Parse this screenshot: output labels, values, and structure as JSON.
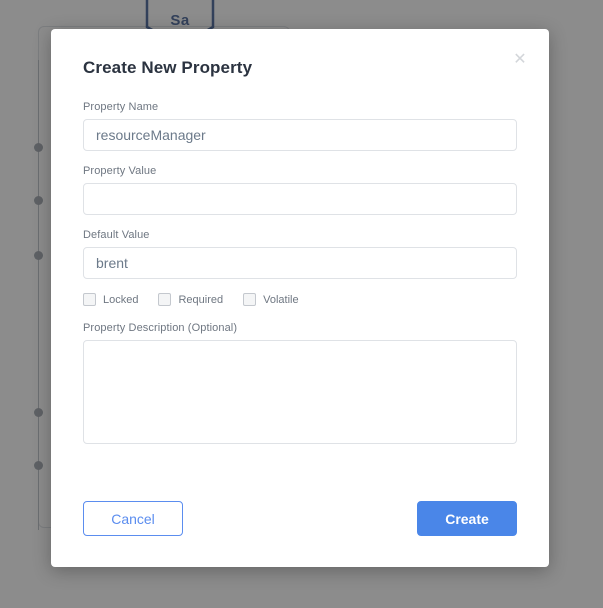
{
  "background": {
    "logo_text": "Sa",
    "logo_icon": "hexagon-icon",
    "tree_dot_positions": [
      147,
      200,
      255,
      412,
      465
    ]
  },
  "modal": {
    "title": "Create New Property",
    "close_icon": "close-icon",
    "fields": {
      "property_name": {
        "label": "Property Name",
        "value": "resourceManager",
        "placeholder": ""
      },
      "property_value": {
        "label": "Property Value",
        "value": "",
        "placeholder": ""
      },
      "default_value": {
        "label": "Default Value",
        "value": "brent",
        "placeholder": ""
      },
      "description": {
        "label": "Property Description (Optional)",
        "value": "",
        "placeholder": ""
      }
    },
    "checkboxes": [
      {
        "label": "Locked",
        "checked": false
      },
      {
        "label": "Required",
        "checked": false
      },
      {
        "label": "Volatile",
        "checked": false
      }
    ],
    "footer": {
      "cancel_label": "Cancel",
      "create_label": "Create"
    }
  },
  "colors": {
    "primary": "#4a86e8",
    "primary_outline": "#5b8def",
    "label_text": "#6f7782",
    "input_text": "#6c7a8a",
    "title_text": "#2b3340",
    "overlay": "rgba(45,45,45,0.55)"
  }
}
